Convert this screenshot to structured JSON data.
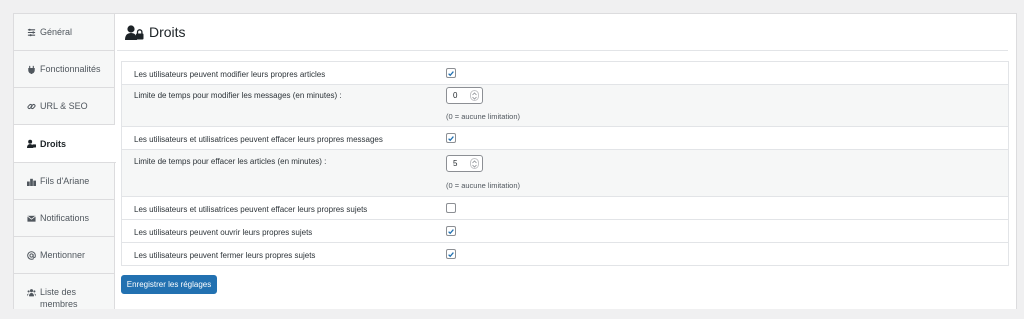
{
  "sidebar": {
    "items": [
      {
        "label": "Général",
        "icon": "sliders-icon"
      },
      {
        "label": "Fonctionnalités",
        "icon": "plug-icon"
      },
      {
        "label": "URL & SEO",
        "icon": "link-icon"
      },
      {
        "label": "Droits",
        "icon": "user-lock-icon"
      },
      {
        "label": "Fils d'Ariane",
        "icon": "breadcrumb-icon"
      },
      {
        "label": "Notifications",
        "icon": "envelope-icon"
      },
      {
        "label": "Mentionner",
        "icon": "at-icon"
      },
      {
        "label_line1": "Liste des",
        "label_line2": "membres",
        "icon": "users-icon"
      }
    ],
    "active": "Droits"
  },
  "page": {
    "title": "Droits"
  },
  "settings": [
    {
      "label": "Les utilisateurs peuvent modifier leurs propres articles",
      "checked": true
    },
    {
      "label": "Limite de temps pour modifier les messages (en minutes) :",
      "value": "0",
      "hint": "(0 = aucune limitation)"
    },
    {
      "label": "Les utilisateurs et utilisatrices peuvent effacer leurs propres messages",
      "checked": true
    },
    {
      "label": "Limite de temps pour effacer les articles (en minutes) :",
      "value": "5",
      "hint": "(0 = aucune limitation)"
    },
    {
      "label": "Les utilisateurs et utilisatrices peuvent effacer leurs propres sujets",
      "checked": false
    },
    {
      "label": "Les utilisateurs peuvent ouvrir leurs propres sujets",
      "checked": true
    },
    {
      "label": "Les utilisateurs peuvent fermer leurs propres sujets",
      "checked": true
    }
  ],
  "save_button": {
    "label": "Enregistrer les réglages"
  },
  "colors": {
    "accent": "#2271b1",
    "check": "#2271b1"
  }
}
